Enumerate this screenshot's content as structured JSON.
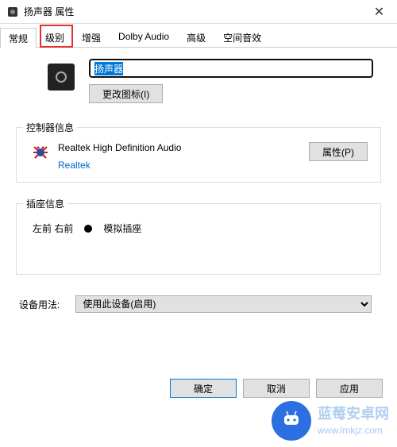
{
  "window": {
    "title": "扬声器 属性"
  },
  "tabs": {
    "items": [
      {
        "label": "常规"
      },
      {
        "label": "级别"
      },
      {
        "label": "增强"
      },
      {
        "label": "Dolby Audio"
      },
      {
        "label": "高级"
      },
      {
        "label": "空间音效"
      }
    ],
    "active_index": 0,
    "highlight_index": 1
  },
  "general": {
    "device_name": "扬声器",
    "change_icon_label": "更改图标(I)"
  },
  "controller": {
    "group_title": "控制器信息",
    "name": "Realtek High Definition Audio",
    "vendor": "Realtek",
    "properties_label": "属性(P)"
  },
  "jack": {
    "group_title": "插座信息",
    "position": "左前 右前",
    "type": "模拟插座"
  },
  "usage": {
    "label": "设备用法:",
    "selected": "使用此设备(启用)"
  },
  "footer": {
    "ok": "确定",
    "cancel": "取消",
    "apply": "应用"
  },
  "watermark": {
    "line1": "蓝莓安卓网",
    "line2": "www.lmkjz.com"
  }
}
